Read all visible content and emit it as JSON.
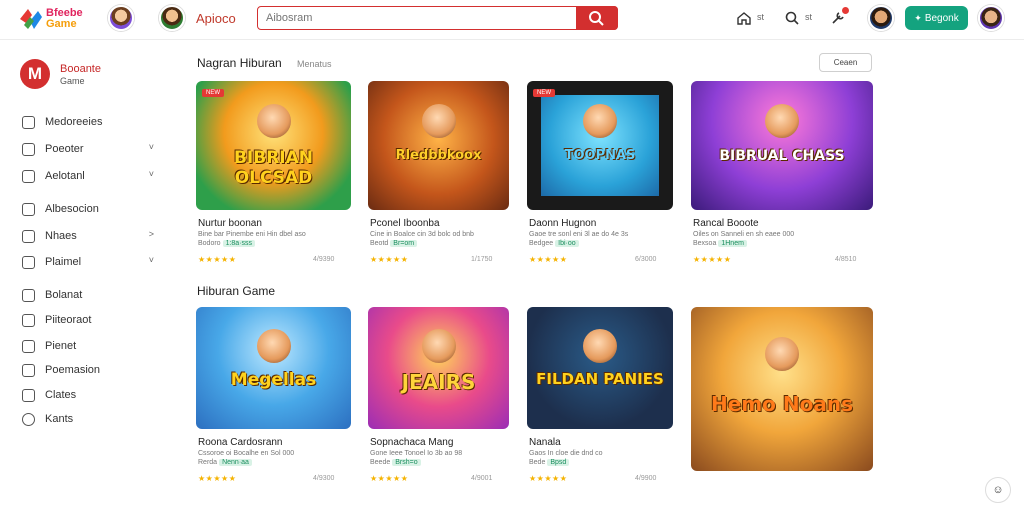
{
  "header": {
    "logo_top": "Bfeebe",
    "logo_bottom": "Game",
    "title": "Apioco",
    "search_placeholder": "Aibosram",
    "home_label": "st",
    "search_label": "st",
    "colors": {
      "accent": "#d32f2f",
      "cta": "#14a37f"
    },
    "cta_label": "Begonk"
  },
  "sidebar": {
    "brand_name": "Booante",
    "brand_sub": "Game",
    "items": [
      {
        "label": "Medoreeies",
        "icon": "square-icon",
        "chevron": ""
      },
      {
        "label": "Poeoter",
        "icon": "square-icon",
        "chevron": "˅"
      },
      {
        "label": "Aelotanl",
        "icon": "square-icon",
        "chevron": "˅"
      },
      {
        "label": "Albesocion",
        "icon": "square-icon",
        "chevron": ""
      },
      {
        "label": "Nhaes",
        "icon": "square-icon",
        "chevron": "˃"
      },
      {
        "label": "Plaimel",
        "icon": "square-icon",
        "chevron": "˅"
      },
      {
        "label": "Bolanat",
        "icon": "square-icon",
        "chevron": ""
      },
      {
        "label": "Piiteoraot",
        "icon": "square-icon",
        "chevron": ""
      },
      {
        "label": "Pienet",
        "icon": "square-icon",
        "chevron": ""
      },
      {
        "label": "Poemasion",
        "icon": "square-icon",
        "chevron": ""
      },
      {
        "label": "Clates",
        "icon": "square-icon",
        "chevron": ""
      },
      {
        "label": "Kants",
        "icon": "circle-icon",
        "chevron": ""
      }
    ]
  },
  "section1": {
    "title": "Nagran Hiburan",
    "sub": "Menatus",
    "button": "Ceaen",
    "cards": [
      {
        "art": "BIBRIAN OLCSAD",
        "tag": "NEW",
        "name": "Nurtur boonan",
        "desc": "Bine bar Pinembe eni Hin dbel aso",
        "badge_pre": "Bodoro",
        "badge": "1:8a·sss",
        "stars": "★★★★★",
        "count": "4/9390"
      },
      {
        "art": "Rledbbkoox",
        "tag": "",
        "name": "Pconel Iboonba",
        "desc": "Cine in Boalce cin 3d bolc od bnb",
        "badge_pre": "Beotd",
        "badge": "Br=om",
        "stars": "★★★★★",
        "count": "1/1750"
      },
      {
        "art": "TOOPNAS",
        "tag": "NEW",
        "name": "Daonn Hugnon",
        "desc": "Gaoe tre sonl eni 3l ae do 4e 3s",
        "badge_pre": "Bedgee",
        "badge": "Ibi·oo",
        "stars": "★★★★★",
        "count": "6/3000"
      },
      {
        "art": "BIBRUAL CHASS",
        "tag": "",
        "name": "Rancal Booote",
        "desc": "Oiles on Sanneli en sh eaee 000",
        "badge_pre": "Bexsoa",
        "badge": "1Hnem",
        "stars": "★★★★★",
        "count": "4/8510"
      }
    ]
  },
  "section2": {
    "title": "Hiburan Game",
    "cards": [
      {
        "art": "Megellas",
        "tag": "",
        "name": "Roona Cardosrann",
        "desc": "Cssoroe oi Bocalhe en Sol 000",
        "badge_pre": "Rerda",
        "badge": "Nenn·aa",
        "stars": "★★★★★",
        "count": "4/9300"
      },
      {
        "art": "JEAIRS",
        "tag": "",
        "name": "Sopnachaca Mang",
        "desc": "Gone Ieee Tonoel Io 3b ao 98",
        "badge_pre": "Beede",
        "badge": "Brsh=o",
        "stars": "★★★★★",
        "count": "4/9001"
      },
      {
        "art": "FILDAN PANIES",
        "tag": "",
        "name": "Nanala",
        "desc": "Gaos In cloe die dnd co",
        "badge_pre": "Bede",
        "badge": "Bpsd",
        "stars": "★★★★★",
        "count": "4/9900"
      },
      {
        "art": "Hemo Noans",
        "tag": "",
        "name": "",
        "desc": "",
        "badge_pre": "",
        "badge": "",
        "stars": "★★★★★",
        "count": ""
      }
    ]
  }
}
